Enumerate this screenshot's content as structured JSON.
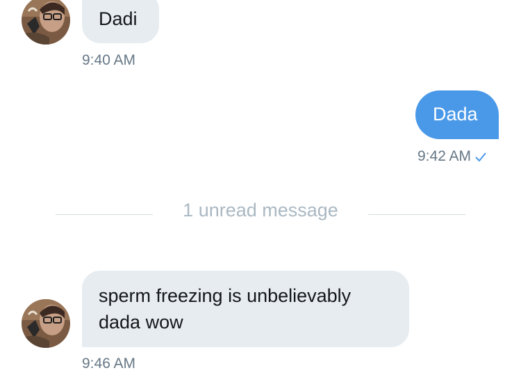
{
  "messages": [
    {
      "direction": "incoming",
      "text": "Dadi",
      "time": "9:40 AM"
    },
    {
      "direction": "outgoing",
      "text": "Dada",
      "time": "9:42 AM",
      "status": "read-check"
    },
    {
      "direction": "incoming",
      "text": "sperm freezing is unbelievably dada wow",
      "time": "9:46 AM"
    }
  ],
  "unread_divider": {
    "label": "1 unread message"
  },
  "colors": {
    "outgoing_bubble": "#4a99e9",
    "incoming_bubble": "#e6ecf0",
    "timestamp": "#657786",
    "check": "#4a99e9",
    "divider_text": "#aab8c2"
  },
  "icons": {
    "avatar": "user-avatar",
    "status": "checkmark-icon"
  }
}
